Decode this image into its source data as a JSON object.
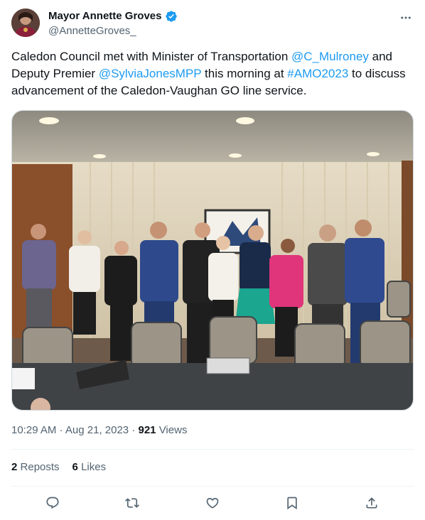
{
  "author": {
    "display_name": "Mayor Annette Groves",
    "handle": "@AnnetteGroves_",
    "verified_icon": "verified-badge-icon",
    "avatar": "avatar"
  },
  "more_icon": "more-options-icon",
  "tweet": {
    "part1": "Caledon Council met with Minister of Transportation ",
    "mention1": "@C_Mulroney",
    "part2": " and Deputy Premier ",
    "mention2": "@SylviaJonesMPP",
    "part3": " this morning at ",
    "hashtag": "#AMO2023",
    "part4": " to discuss advancement of the Caledon-Vaughan GO line service."
  },
  "media": {
    "type": "photo",
    "description_icon": "group-photo"
  },
  "meta": {
    "time": "10:29 AM",
    "sep1": "·",
    "date": "Aug 21, 2023",
    "sep2": "·",
    "views_count": "921",
    "views_label": "Views"
  },
  "stats": {
    "reposts_count": "2",
    "reposts_label": "Reposts",
    "likes_count": "6",
    "likes_label": "Likes"
  },
  "actions": [
    "reply-icon",
    "repost-icon",
    "like-icon",
    "bookmark-icon",
    "share-icon"
  ],
  "colors": {
    "link": "#1d9bf0",
    "verified": "#1d9bf0",
    "muted": "#536471",
    "text": "#0f1419"
  }
}
